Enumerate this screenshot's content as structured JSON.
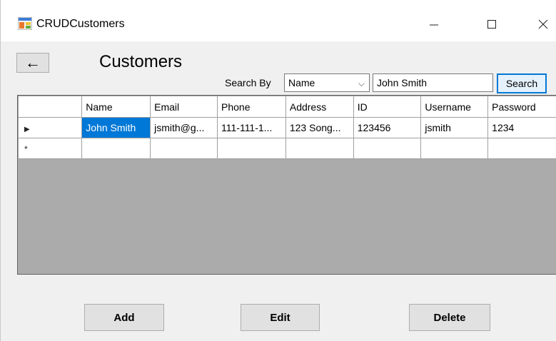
{
  "window": {
    "title": "CRUDCustomers",
    "controls": {
      "minimize": "—",
      "maximize": "☐",
      "close": "✕"
    }
  },
  "toolbar": {
    "back_label": "←",
    "page_title": "Customers",
    "search_by_label": "Search By",
    "search_field": "Name",
    "search_field_chevron": "⌵",
    "search_value": "John Smith",
    "search_button": "Search"
  },
  "grid": {
    "columns": [
      "Name",
      "Email",
      "Phone",
      "Address",
      "ID",
      "Username",
      "Password"
    ],
    "rows": [
      [
        "John Smith",
        "jsmith@g...",
        "111-111-1...",
        "123 Song...",
        "123456",
        "jsmith",
        "1234"
      ]
    ],
    "current_row_marker": "▶",
    "new_row_marker": "*"
  },
  "actions": {
    "add": "Add",
    "edit": "Edit",
    "delete": "Delete"
  },
  "colors": {
    "selection": "#0078d7",
    "grid_background": "#ababab",
    "window_background": "#f0f0f0"
  }
}
